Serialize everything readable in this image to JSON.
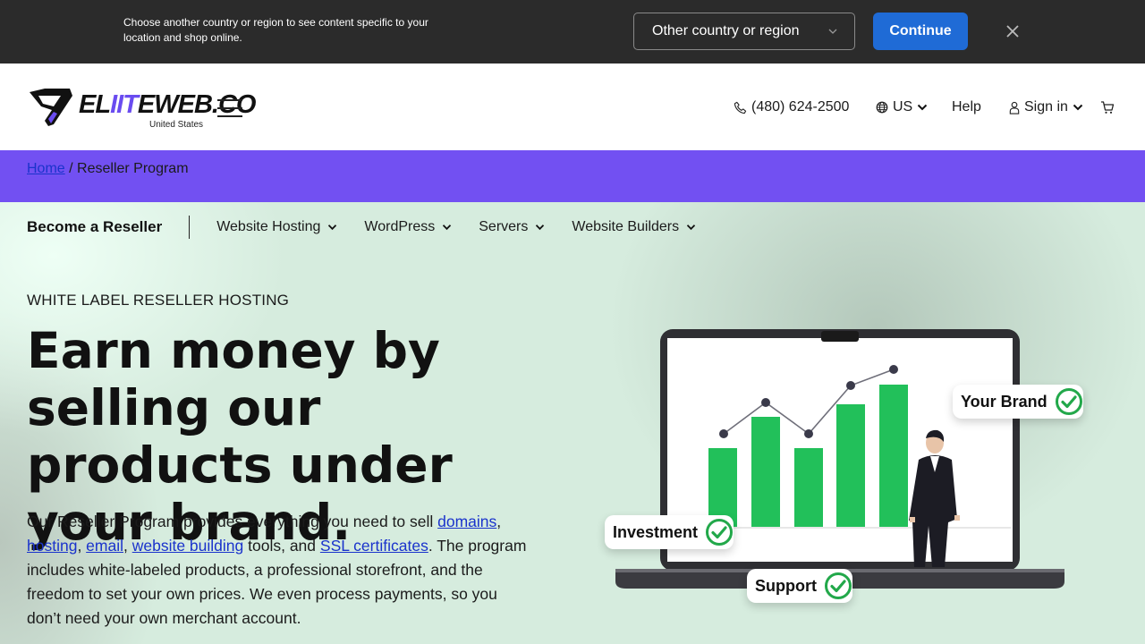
{
  "country_banner": {
    "message": "Choose another country or region to see content specific to your location and shop online.",
    "select_value": "Other country or region",
    "continue_label": "Continue"
  },
  "header": {
    "logo_text_a": "EL",
    "logo_text_b": "IIT",
    "logo_text_c": "EWEB.CO",
    "logo_sub": "United States",
    "phone": "(480) 624-2500",
    "region": "US",
    "help": "Help",
    "sign_in": "Sign in"
  },
  "breadcrumb": {
    "home": "Home",
    "separator": "/",
    "current": "Reseller Program"
  },
  "subnav": {
    "title": "Become a Reseller",
    "items": [
      "Website Hosting",
      "WordPress",
      "Servers",
      "Website Builders"
    ]
  },
  "hero": {
    "eyebrow": "WHITE LABEL RESELLER HOSTING",
    "headline": "Earn money by selling our products under your brand.",
    "lede_1": "Our Reseller Program provides everything you need to sell ",
    "link_domains": "domains",
    "comma_1": ",",
    "link_hosting": "hosting",
    "comma_2": ", ",
    "link_email": "email",
    "comma_3": ", ",
    "link_website_building": "website building",
    "lede_2": " tools, and ",
    "link_ssl": "SSL certificates",
    "lede_3": ". The program includes white-labeled products, a professional storefront, and the freedom to set your own prices. We even process payments, so you don’t need your own merchant account."
  },
  "illustration": {
    "badge_investment": "Investment",
    "badge_brand": "Your Brand",
    "badge_support": "Support"
  },
  "colors": {
    "banner_bg": "#2b2b2b",
    "continue_blue": "#1f6bd6",
    "breadcrumb_purple": "#7250f2",
    "hero_green": "#d6ecde",
    "chart_green": "#22c05a",
    "link_blue": "#1a33cc"
  },
  "icons": [
    "chevron-down-icon",
    "close-icon",
    "menu-icon",
    "phone-icon",
    "globe-icon",
    "user-icon",
    "cart-icon",
    "checkmark-icon"
  ]
}
